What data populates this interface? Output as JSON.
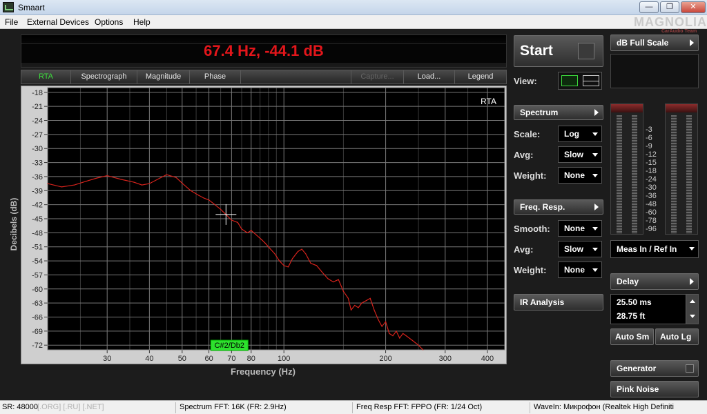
{
  "window": {
    "title": "Smaart"
  },
  "window_controls": {
    "minimize": "—",
    "maximize": "❐",
    "close": "✕"
  },
  "menu": [
    "File",
    "External Devices",
    "Options",
    "Help"
  ],
  "watermark": {
    "text": "MAGNOLIA",
    "sub": "CarAudio Team"
  },
  "readout": "67.4 Hz, -44.1 dB",
  "tabs": [
    {
      "label": "RTA",
      "state": "active"
    },
    {
      "label": "Spectrograph",
      "state": "normal"
    },
    {
      "label": "Magnitude",
      "state": "normal"
    },
    {
      "label": "Phase",
      "state": "normal"
    },
    {
      "label": "Capture...",
      "state": "disabled"
    },
    {
      "label": "Load...",
      "state": "normal"
    },
    {
      "label": "Legend",
      "state": "normal"
    }
  ],
  "plot": {
    "mode_label": "RTA",
    "xlabel": "Frequency (Hz)",
    "ylabel": "Decibels (dB)",
    "note_label": "C#2/Db2"
  },
  "chart_data": {
    "type": "line",
    "x_scale": "log",
    "xlim": [
      20,
      450
    ],
    "ylim": [
      -73,
      -17
    ],
    "grid": true,
    "x_ticks": [
      30,
      40,
      50,
      60,
      70,
      80,
      100,
      200,
      300,
      400
    ],
    "y_ticks": [
      -18,
      -21,
      -24,
      -27,
      -30,
      -33,
      -36,
      -39,
      -42,
      -45,
      -48,
      -51,
      -54,
      -57,
      -60,
      -63,
      -66,
      -69,
      -72
    ],
    "cursor": {
      "x": 67.4,
      "y": -44.1
    },
    "series": [
      {
        "color": "#d6231c",
        "points": [
          [
            20,
            -37.5
          ],
          [
            22,
            -38.2
          ],
          [
            24,
            -37.8
          ],
          [
            26,
            -37.0
          ],
          [
            28,
            -36.3
          ],
          [
            30,
            -35.8
          ],
          [
            33,
            -36.6
          ],
          [
            36,
            -37.2
          ],
          [
            38,
            -37.8
          ],
          [
            40,
            -37.5
          ],
          [
            43,
            -36.3
          ],
          [
            45,
            -35.6
          ],
          [
            48,
            -36.2
          ],
          [
            50,
            -37.4
          ],
          [
            53,
            -39.0
          ],
          [
            56,
            -40.0
          ],
          [
            58,
            -40.6
          ],
          [
            60,
            -41.0
          ],
          [
            62,
            -41.8
          ],
          [
            65,
            -43.0
          ],
          [
            67.4,
            -44.1
          ],
          [
            70,
            -45.3
          ],
          [
            73,
            -45.8
          ],
          [
            75,
            -47.2
          ],
          [
            78,
            -48.0
          ],
          [
            80,
            -47.5
          ],
          [
            83,
            -48.5
          ],
          [
            86,
            -49.5
          ],
          [
            88,
            -50.2
          ],
          [
            90,
            -51.0
          ],
          [
            94,
            -52.5
          ],
          [
            97,
            -54.0
          ],
          [
            100,
            -55.0
          ],
          [
            103,
            -55.3
          ],
          [
            106,
            -53.5
          ],
          [
            110,
            -52.0
          ],
          [
            113,
            -51.5
          ],
          [
            116,
            -52.5
          ],
          [
            120,
            -54.5
          ],
          [
            125,
            -55.0
          ],
          [
            130,
            -56.5
          ],
          [
            135,
            -57.8
          ],
          [
            140,
            -58.5
          ],
          [
            145,
            -58.0
          ],
          [
            150,
            -60.5
          ],
          [
            155,
            -62.0
          ],
          [
            158,
            -64.5
          ],
          [
            162,
            -63.5
          ],
          [
            166,
            -64.0
          ],
          [
            170,
            -63.0
          ],
          [
            175,
            -62.5
          ],
          [
            180,
            -62.0
          ],
          [
            185,
            -64.5
          ],
          [
            190,
            -66.5
          ],
          [
            195,
            -68.0
          ],
          [
            200,
            -67.0
          ],
          [
            205,
            -69.5
          ],
          [
            210,
            -70.0
          ],
          [
            215,
            -69.0
          ],
          [
            220,
            -70.5
          ],
          [
            225,
            -69.5
          ],
          [
            230,
            -70.0
          ],
          [
            240,
            -71.0
          ],
          [
            250,
            -72.0
          ],
          [
            258,
            -73.0
          ]
        ]
      }
    ]
  },
  "right": {
    "start_label": "Start",
    "view_label": "View:",
    "spectrum": "Spectrum",
    "scale_label": "Scale:",
    "scale_value": "Log",
    "avg_label": "Avg:",
    "avg_value": "Slow",
    "weight_label": "Weight:",
    "weight_value": "None",
    "freq_resp": "Freq. Resp.",
    "smooth_label": "Smooth:",
    "smooth_value": "None",
    "avg2_label": "Avg:",
    "avg2_value": "Slow",
    "weight2_label": "Weight:",
    "weight2_value": "None",
    "ir_analysis": "IR Analysis",
    "db_full_scale": "dB Full Scale",
    "meter_scale": [
      "-3",
      "-6",
      "-9",
      "-12",
      "-15",
      "-18",
      "-24",
      "-30",
      "-36",
      "-48",
      "-60",
      "-78",
      "-96"
    ],
    "meas_in": "Meas In / Ref In",
    "delay": "Delay",
    "delay_ms": "25.50 ms",
    "delay_ft": "28.75 ft",
    "auto_sm": "Auto Sm",
    "auto_lg": "Auto Lg",
    "generator": "Generator",
    "pink_noise": "Pink Noise"
  },
  "status": {
    "sr": "SR: 48000",
    "spectrum_fft": "Spectrum FFT: 16K (FR: 2.9Hz)",
    "freq_resp_fft": "Freq Resp FFT: FPPO (FR: 1/24 Oct)",
    "wavein": "WaveIn: Микрофон (Realtek High Definiti",
    "faint": "[.ORG] [.RU] [.NET]"
  }
}
